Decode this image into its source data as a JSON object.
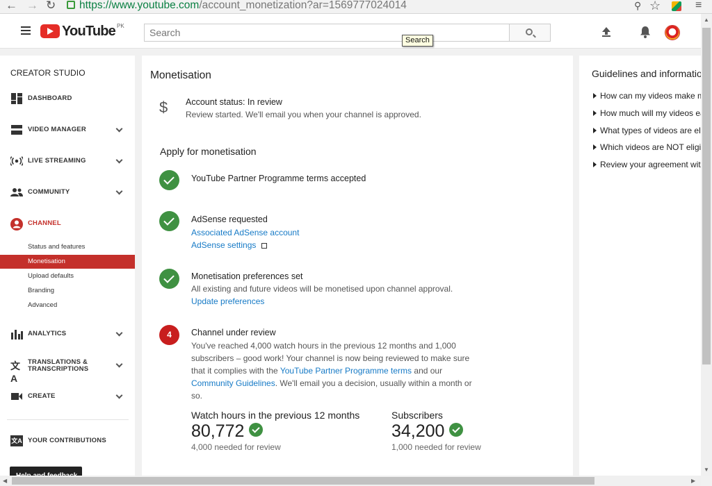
{
  "browser": {
    "url_secure": "https://www.youtube.com",
    "url_rest": "/account_monetization?ar=1569777024014"
  },
  "header": {
    "logo_text": "YouTube",
    "country": "PK",
    "search_placeholder": "Search",
    "search_tooltip": "Search"
  },
  "sidebar": {
    "heading": "CREATOR STUDIO",
    "items": [
      {
        "label": "DASHBOARD",
        "icon": "dashboard-icon"
      },
      {
        "label": "VIDEO MANAGER",
        "icon": "video-manager-icon"
      },
      {
        "label": "LIVE STREAMING",
        "icon": "live-streaming-icon"
      },
      {
        "label": "COMMUNITY",
        "icon": "community-icon"
      },
      {
        "label": "CHANNEL",
        "icon": "channel-icon"
      },
      {
        "label": "ANALYTICS",
        "icon": "analytics-icon"
      },
      {
        "label": "TRANSLATIONS &",
        "label2": "TRANSCRIPTIONS",
        "icon": "translate-icon"
      },
      {
        "label": "CREATE",
        "icon": "create-icon"
      },
      {
        "label": "YOUR CONTRIBUTIONS",
        "icon": "contributions-icon"
      }
    ],
    "channel_subitems": [
      "Status and features",
      "Monetisation",
      "Upload defaults",
      "Branding",
      "Advanced"
    ],
    "help_button": "Help and feedback"
  },
  "main": {
    "title": "Monetisation",
    "account_status": "Account status: In review",
    "account_desc": "Review started. We'll email you when your channel is approved.",
    "apply_title": "Apply for monetisation",
    "steps": {
      "s1": {
        "title": "YouTube Partner Programme terms accepted"
      },
      "s2": {
        "title": "AdSense requested",
        "link1": "Associated AdSense account",
        "link2": "AdSense settings"
      },
      "s3": {
        "title": "Monetisation preferences set",
        "desc": "All existing and future videos will be monetised upon channel approval.",
        "link": "Update preferences"
      },
      "s4": {
        "number": "4",
        "title": "Channel under review",
        "desc_part1": "You've reached 4,000 watch hours in the previous 12 months and 1,000",
        "desc_part2": "subscribers – good work! Your channel is now being reviewed to make sure",
        "desc_part3": "that it complies with the",
        "link_terms": "YouTube Partner Programme terms",
        "desc_part4": "and our",
        "link_guidelines": "Community Guidelines",
        "desc_part5": ". We'll email you a decision, usually within a month or",
        "desc_part6": "so."
      }
    },
    "stats": {
      "watch": {
        "label": "Watch hours in the previous 12 months",
        "value": "80,772",
        "needed": "4,000 needed for review"
      },
      "subs": {
        "label": "Subscribers",
        "value": "34,200",
        "needed": "1,000 needed for review"
      }
    }
  },
  "guidelines": {
    "title": "Guidelines and information",
    "items": [
      "How can my videos make money?",
      "How much will my videos earn?",
      "What types of videos are eligible?",
      "Which videos are NOT eligible?",
      "Review your agreement with YouTube"
    ]
  },
  "colors": {
    "accent_red": "#c4302b",
    "link_blue": "#167ac6",
    "check_green": "#3f9142"
  }
}
